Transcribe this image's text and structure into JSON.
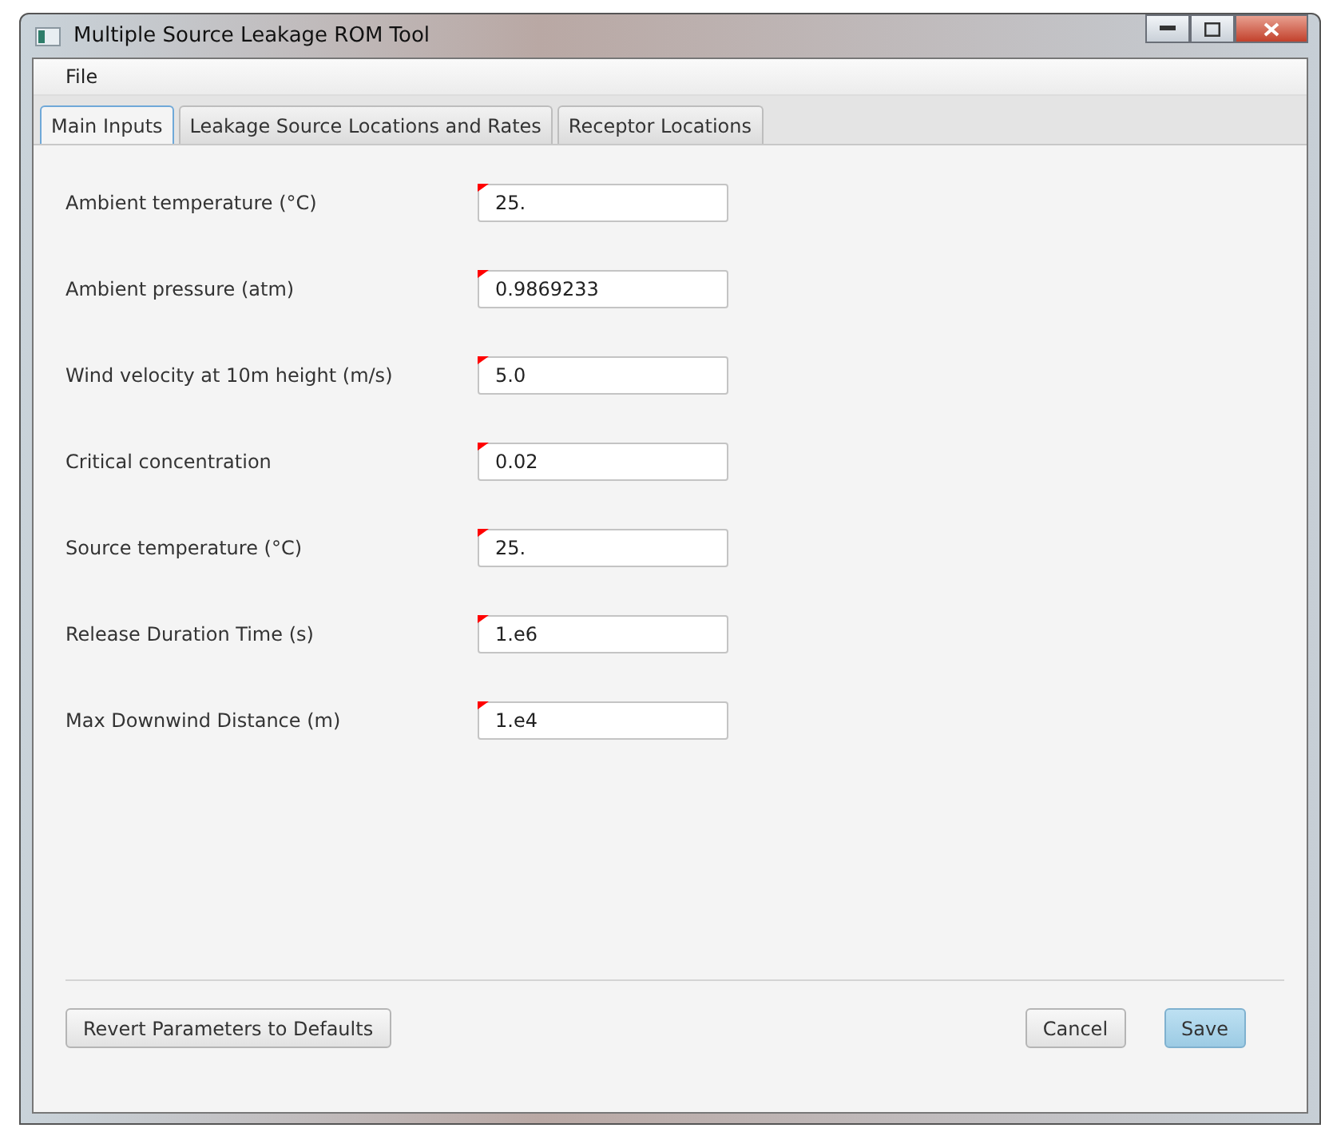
{
  "window": {
    "title": "Multiple Source Leakage ROM Tool"
  },
  "menu": [
    "File"
  ],
  "tabs": [
    {
      "label": "Main Inputs",
      "selected": true
    },
    {
      "label": "Leakage Source Locations and Rates",
      "selected": false
    },
    {
      "label": "Receptor Locations",
      "selected": false
    }
  ],
  "fields": [
    {
      "label": "Ambient temperature (°C)",
      "value": "25."
    },
    {
      "label": "Ambient pressure (atm)",
      "value": "0.9869233"
    },
    {
      "label": "Wind velocity at 10m height (m/s)",
      "value": "5.0"
    },
    {
      "label": "Critical concentration",
      "value": "0.02"
    },
    {
      "label": "Source temperature (°C)",
      "value": "25."
    },
    {
      "label": "Release Duration Time (s)",
      "value": "1.e6"
    },
    {
      "label": "Max Downwind Distance (m)",
      "value": "1.e4"
    }
  ],
  "footer": {
    "left_buttons": [
      {
        "label": "Revert Parameters to Defaults",
        "default": false
      }
    ],
    "right_buttons": [
      {
        "label": "Cancel",
        "default": false
      },
      {
        "label": "Save",
        "default": true
      }
    ]
  }
}
